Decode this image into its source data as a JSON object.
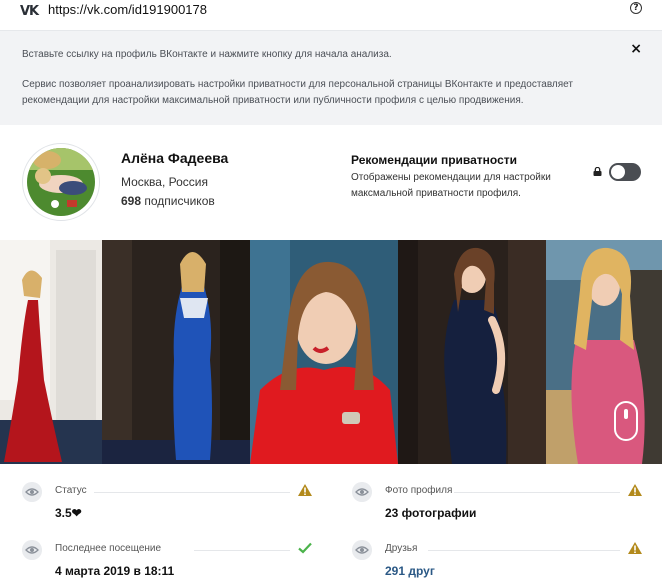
{
  "urlbar": {
    "logo": "VK",
    "url": "https://vk.com/id191900178",
    "help_icon": "help-circle-icon",
    "help_symbol": "?"
  },
  "info": {
    "line1": "Вставьте ссылку на профиль ВКонтакте и нажмите кнопку для начала анализа.",
    "line2": "Сервис позволяет проанализировать настройки приватности для персональной страницы ВКонтакте и предоставляет",
    "line3": "рекомендации для настройки максимальной приватности или публичности профиля с целью продвижения.",
    "close_symbol": "×"
  },
  "profile": {
    "name": "Алёна Фадеева",
    "city": "Москва, Россия",
    "subscribers_count": "698",
    "subscribers_label": "подписчиков"
  },
  "recommendations": {
    "title": "Рекомендации приватности",
    "description": "Отображены рекомендации для настройки максмальной приватности профиля.",
    "toggle_on": false
  },
  "gallery": {
    "photos": [
      {
        "bg": "#e8e6e2",
        "accent": "#b4151c"
      },
      {
        "bg": "#2b231e",
        "accent": "#1f53b8"
      },
      {
        "bg": "#2f5d78",
        "accent": "#e01a1f"
      },
      {
        "bg": "#2a211c",
        "accent": "#15203e"
      },
      {
        "bg": "#4a6f86",
        "accent": "#d9587e"
      }
    ]
  },
  "stats": {
    "status": {
      "label": "Статус",
      "value": "3.5❤",
      "state": "warning"
    },
    "photo": {
      "label": "Фото профиля",
      "value": "23 фотографии",
      "state": "warning"
    },
    "last_seen": {
      "label": "Последнее посещение",
      "value": "4 марта 2019 в 18:11",
      "state": "ok"
    },
    "friends": {
      "label": "Друзья",
      "value": "291 друг",
      "state": "warning"
    }
  },
  "colors": {
    "warning": "#b38a1c",
    "ok": "#4bb34b",
    "link": "#2a5885"
  }
}
